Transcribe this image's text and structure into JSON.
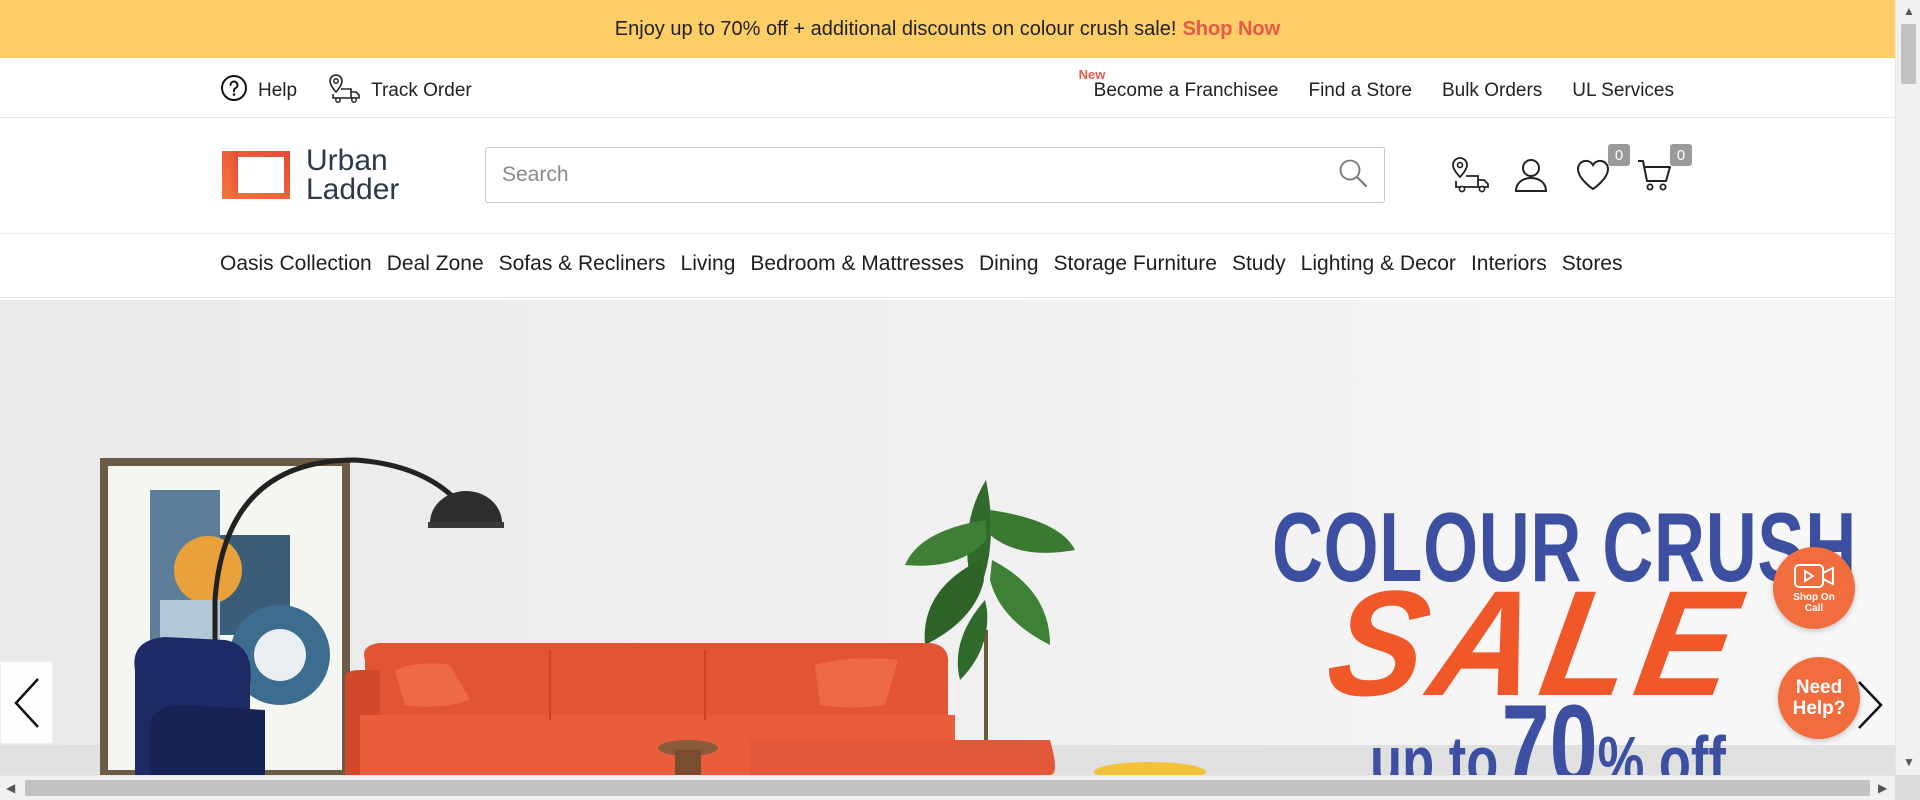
{
  "promo": {
    "text": "Enjoy up to 70% off + additional discounts on colour crush sale!",
    "link": "Shop Now"
  },
  "utility": {
    "help": "Help",
    "track_order": "Track Order",
    "new_tag": "New",
    "franchisee": "Become a Franchisee",
    "find_store": "Find a Store",
    "bulk_orders": "Bulk Orders",
    "ul_services": "UL Services"
  },
  "logo": {
    "line1": "Urban",
    "line2": "Ladder"
  },
  "search": {
    "placeholder": "Search",
    "value": ""
  },
  "header_icons": {
    "store_locator": "store-locator-icon",
    "profile": "user-icon",
    "wishlist": "heart-icon",
    "wishlist_count": "0",
    "cart": "cart-icon",
    "cart_count": "0"
  },
  "nav": [
    "Oasis Collection",
    "Deal Zone",
    "Sofas & Recliners",
    "Living",
    "Bedroom & Mattresses",
    "Dining",
    "Storage Furniture",
    "Study",
    "Lighting & Decor",
    "Interiors",
    "Stores"
  ],
  "hero": {
    "headline": "COLOUR CRUSH",
    "sale": "SALE",
    "offer_prefix": "up to",
    "offer_value": "70",
    "offer_suffix": "% off"
  },
  "floating": {
    "shop_on_call_line1": "Shop On",
    "shop_on_call_line2": "Call",
    "need_help_line1": "Need",
    "need_help_line2": "Help?"
  },
  "colors": {
    "promo_bg": "#fdcd66",
    "accent": "#e8594a",
    "hero_blue": "#3c4fa0",
    "hero_orange": "#f0582a",
    "float_btn": "#f26d3d"
  }
}
